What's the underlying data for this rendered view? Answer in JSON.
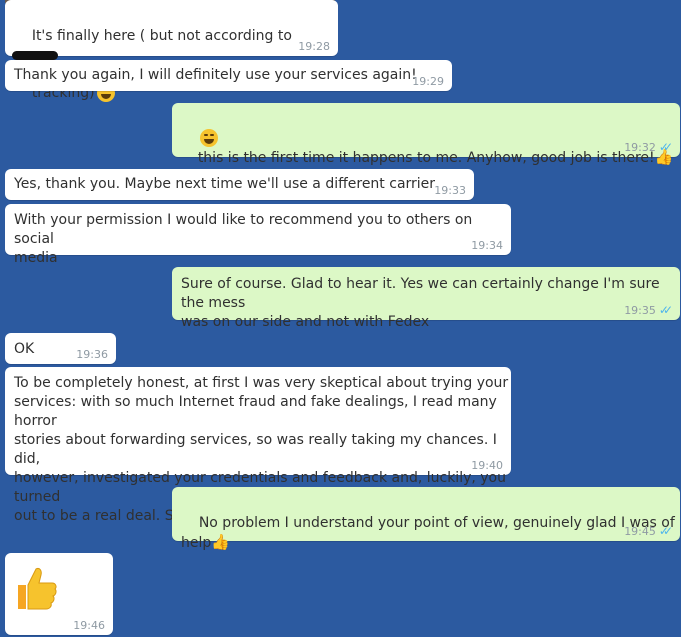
{
  "messages": [
    {
      "text_a": "It's finally here ( but not according to ",
      "text_b": "tracking)",
      "time": "19:28"
    },
    {
      "text": "Thank you again, I will definitely use your services again!",
      "time": "19:29"
    },
    {
      "text": "this is the first time it happens to me. Anyhow, good job is there!",
      "time": "19:32"
    },
    {
      "text": "Yes, thank you. Maybe next time we'll use a different carrier",
      "time": "19:33"
    },
    {
      "text": "With your permission I would like to recommend you to others on social\nmedia",
      "time": "19:34"
    },
    {
      "text": "Sure of course. Glad to hear it. Yes we can certainly change I'm sure the mess\nwas on our side and not with Fedex",
      "time": "19:35"
    },
    {
      "text": "OK",
      "time": "19:36"
    },
    {
      "text": "To be completely honest, at first I was very skeptical about trying your\nservices: with so much Internet fraud and fake dealings, I read many horror\nstories about forwarding services, so was really taking my chances. I did,\nhowever, investigated your credentials and feedback and, luckily, you turned\nout to be a real deal. So, thank you again!",
      "time": "19:40"
    },
    {
      "text": "No problem I understand your point of view, genuinely glad I was of help",
      "time": "19:45"
    },
    {
      "text": "",
      "time": "19:46"
    }
  ],
  "colors": {
    "background": "#2c5aa0",
    "incoming": "#ffffff",
    "outgoing": "#dcf8c6",
    "ticks": "#4fb6ec"
  }
}
